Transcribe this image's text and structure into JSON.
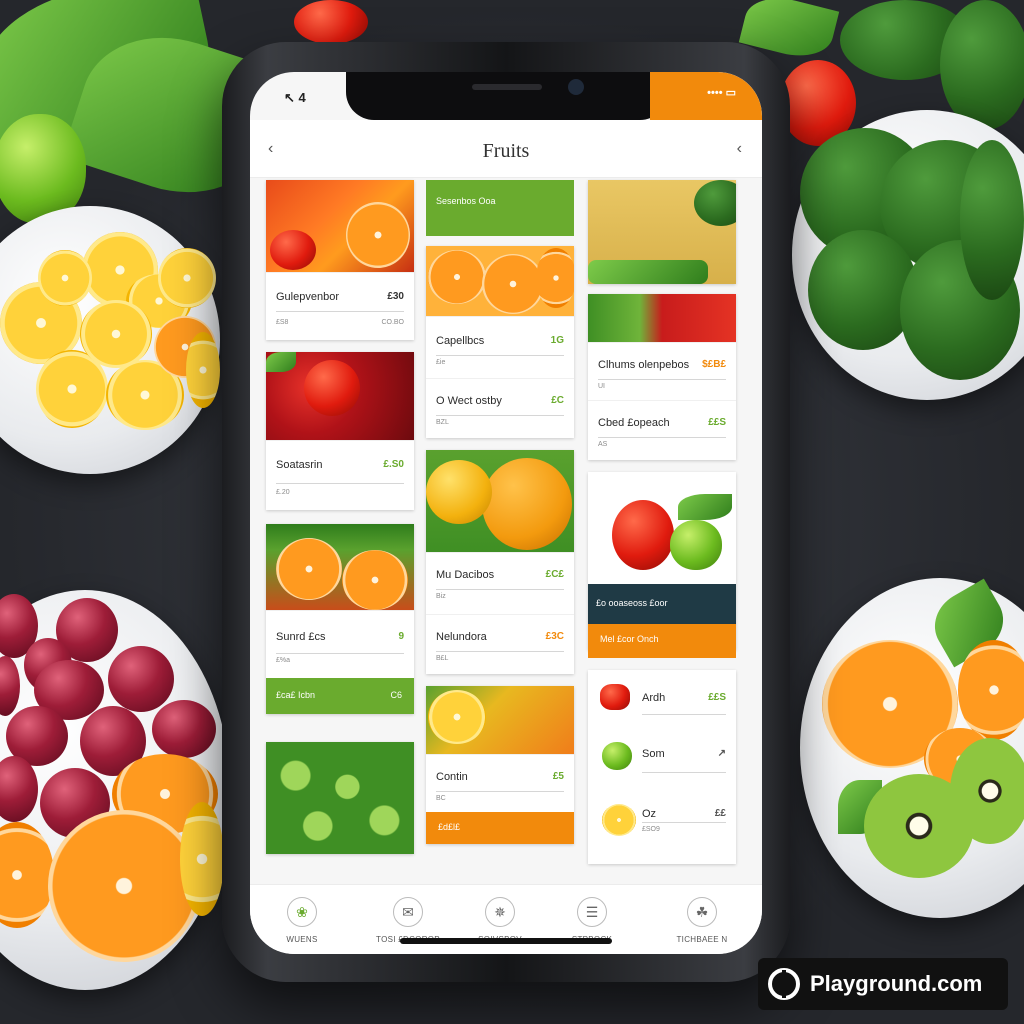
{
  "status": {
    "left": "↖ 4",
    "right": "•••• ▭"
  },
  "header": {
    "title": "Fruits",
    "back_icon": "‹",
    "menu_icon": "‹"
  },
  "col1": {
    "c1": {
      "name": "Gulepvenbor",
      "price": "£30",
      "sub": "£S8",
      "sub2": "CO.BO"
    },
    "c2": {
      "name": "Soatasrin",
      "price": "£.S0",
      "sub": "£.20"
    },
    "c3": {
      "name": "Sunrd £cs",
      "price": "9",
      "sub": "£%a"
    },
    "bar1": {
      "left": "£ca£ Icbn",
      "right": "C6"
    }
  },
  "col2": {
    "banner": "Sesenbos Ooa",
    "c1a": {
      "name": "Capellbcs",
      "price": "1G",
      "sub": "£ie"
    },
    "c1b": {
      "name": "O Wect ostby",
      "price": "£C",
      "sub": "BZL"
    },
    "c2a": {
      "name": "Mu Dacibos",
      "price": "£C£",
      "sub": "Biz"
    },
    "c2b": {
      "name": "Nelundora",
      "price": "£3C",
      "sub": "B£L"
    },
    "c3": {
      "name": "Contin",
      "price": "£5",
      "sub": "BC"
    },
    "bar": "£d£l£"
  },
  "col3": {
    "c1a": {
      "name": "Clhums olenpebos",
      "price": "$£B£",
      "sub": "UI"
    },
    "c1b": {
      "name": "Cbed £opeach",
      "price": "££S",
      "sub": "AS"
    },
    "dark_bar": "£o ooaseoss £oor",
    "orange_bar": "Mel £cor Onch",
    "list": [
      {
        "name": "Ardh",
        "price": "££S"
      },
      {
        "name": "Som",
        "price": "↗"
      },
      {
        "name": "Oz",
        "price": "££",
        "sub": "£SO9"
      }
    ]
  },
  "nav": [
    {
      "icon": "❀",
      "label": "WUENS"
    },
    {
      "icon": "✉",
      "label": "TOSI £DCOROP"
    },
    {
      "icon": "✵",
      "label": "SOIVSBOV"
    },
    {
      "icon": "☰",
      "label": "STPBOCK"
    },
    {
      "icon": "☘",
      "label": "TICHBAEE N"
    }
  ],
  "watermark": "Playground.com",
  "colors": {
    "green": "#6aab2e",
    "orange": "#f28a0c",
    "dark": "#1f3a45"
  }
}
